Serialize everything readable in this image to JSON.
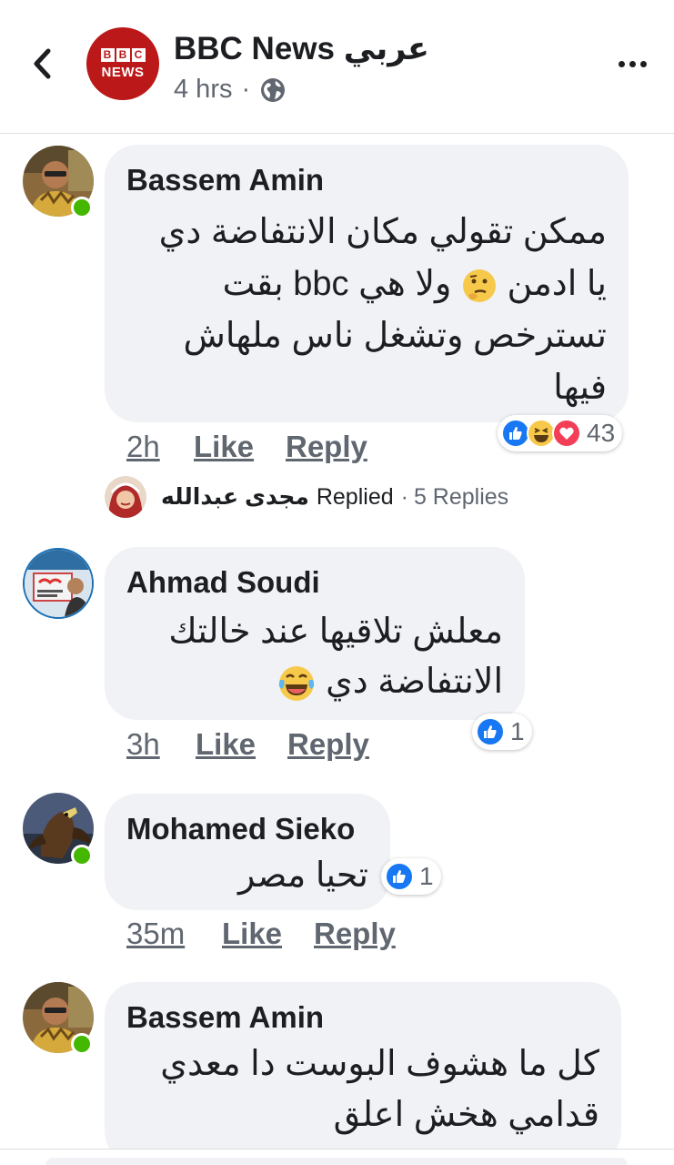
{
  "header": {
    "page_name": "BBC News عربي",
    "logo_letters": [
      "B",
      "B",
      "C"
    ],
    "logo_word": "NEWS",
    "time": "4 hrs",
    "separator": "·",
    "brand_color": "#bb1919"
  },
  "comments": [
    {
      "author": "Bassem Amin",
      "lines": [
        "ممكن تقولي مكان الانتفاضة دي",
        "يا ادمن",
        "ولا هي bbc بقت",
        "تسترخص وتشغل ناس ملهاش",
        "فيها"
      ],
      "emoji": "thinking-face",
      "time": "2h",
      "like": "Like",
      "reply": "Reply",
      "reactions": [
        "like",
        "haha",
        "love"
      ],
      "reaction_count": "43",
      "online": true
    },
    {
      "author": "Ahmad Soudi",
      "lines": [
        "معلش تلاقيها عند خالتك",
        "الانتفاضة دي"
      ],
      "emoji": "tears-of-joy",
      "time": "3h",
      "like": "Like",
      "reply": "Reply",
      "reactions": [
        "like"
      ],
      "reaction_count": "1",
      "online": false
    },
    {
      "author": "Mohamed Sieko",
      "lines": [
        "تحيا مصر"
      ],
      "time": "35m",
      "like": "Like",
      "reply": "Reply",
      "reactions": [
        "like"
      ],
      "reaction_count": "1",
      "online": true
    },
    {
      "author": "Bassem Amin",
      "lines": [
        "كل ما هشوف البوست دا معدي",
        "قدامي  هخش اعلق"
      ],
      "online": true
    }
  ],
  "replies_summary": {
    "name": "مجدى عبدالله",
    "replied": "Replied",
    "separator": "·",
    "count": "5 Replies"
  },
  "colors": {
    "bubble": "#f0f2f5",
    "like_blue": "#1877f2",
    "love_red": "#f33e58",
    "haha_yellow": "#f7c94b",
    "online_green": "#44b700"
  }
}
